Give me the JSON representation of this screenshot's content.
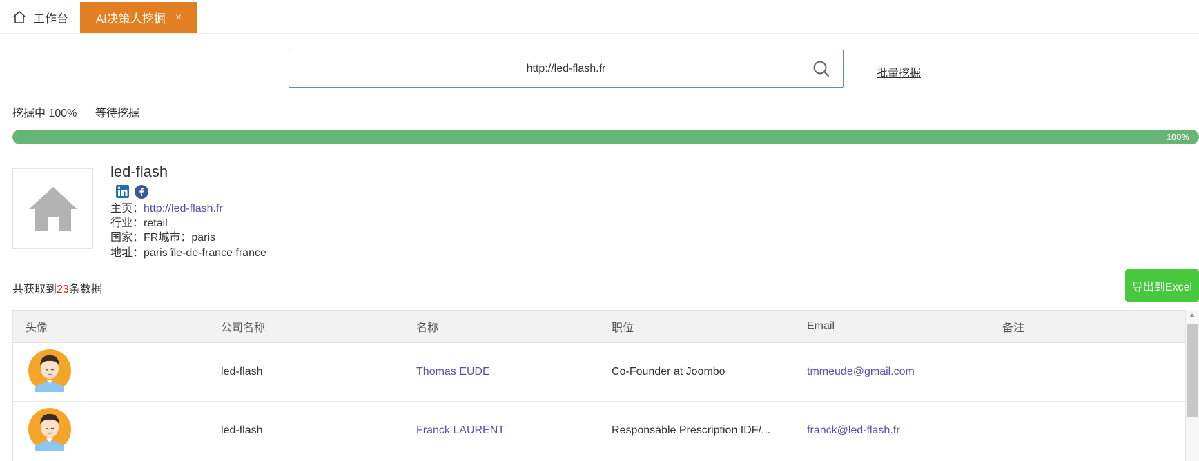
{
  "tabs": {
    "home_label": "工作台",
    "active_label": "AI决策人挖掘",
    "close_glyph": "×"
  },
  "search": {
    "value": "http://led-flash.fr"
  },
  "batch_link": "批量挖掘",
  "status": {
    "mining": "挖掘中 100%",
    "waiting": "等待挖掘"
  },
  "progress": {
    "percent": 100,
    "label": "100%"
  },
  "company": {
    "name": "led-flash",
    "homepage_label": "主页：",
    "homepage": "http://led-flash.fr",
    "industry_label": "行业：",
    "industry": "retail",
    "country_label": "国家：",
    "country": "FR",
    "city_label": "城市：",
    "city": "paris",
    "address_label": "地址：",
    "address": "paris île-de-france france",
    "social_icons": [
      "linkedin-icon",
      "facebook-icon"
    ]
  },
  "summary": {
    "prefix": "共获取到",
    "count": "23",
    "suffix": "条数据"
  },
  "export_label": "导出到Excel",
  "table": {
    "headers": [
      "头像",
      "公司名称",
      "名称",
      "职位",
      "Email",
      "备注"
    ],
    "rows": [
      {
        "company": "led-flash",
        "name": "Thomas EUDE",
        "position": "Co-Founder at Joombo",
        "email": "tmmeude@gmail.com",
        "note": ""
      },
      {
        "company": "led-flash",
        "name": "Franck LAURENT",
        "position": "Responsable Prescription IDF/...",
        "email": "franck@led-flash.fr",
        "note": ""
      }
    ]
  },
  "colors": {
    "accent_tab": "#e27f22",
    "progress": "#66b574",
    "export": "#47c83e",
    "link": "#5a4fb0",
    "count": "#e02020"
  }
}
